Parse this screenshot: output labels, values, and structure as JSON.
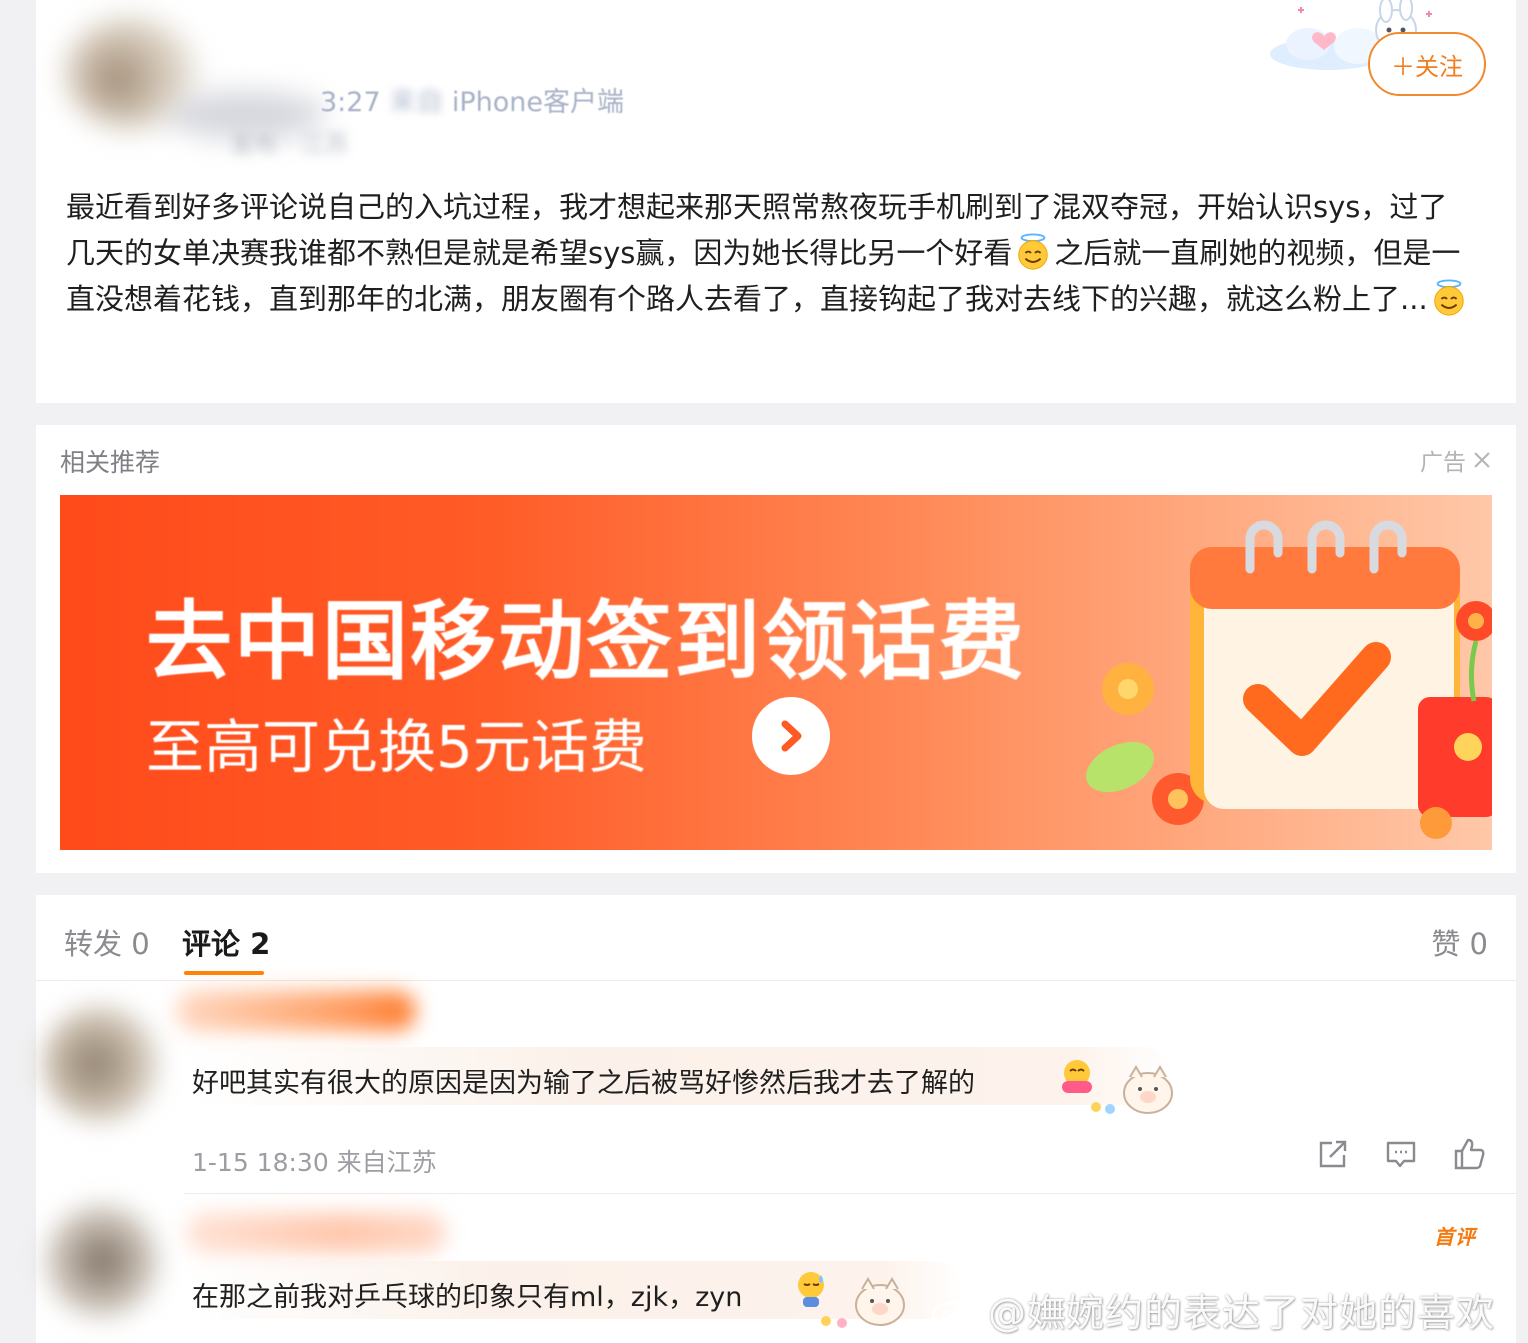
{
  "post": {
    "meta_time": "3:27",
    "meta_source": "iPhone客户端",
    "follow_label": "＋关注",
    "text_part1": "最近看到好多评论说自己的入坑过程，我才想起来那天照常熬夜玩手机刷到了混双夺冠，开始认识sys，过了几天的女单决赛我谁都不熟但是就是希望sys赢，因为她长得比另一个好看",
    "text_part2": "之后就一直刷她的视频，但是一直没想着花钱，直到那年的北满，朋友圈有个路人去看了，直接钩起了我对去线下的兴趣，就这么粉上了...",
    "emoji": "smiling-face-with-halo"
  },
  "related": {
    "title": "相关推荐",
    "ad_label": "广告",
    "ad": {
      "title": "去中国移动签到领话费",
      "subtitle": "至高可兑换5元话费",
      "brand_color": "#ff4a1a"
    }
  },
  "tabs": {
    "repost": "转发 0",
    "comment": "评论 2",
    "like": "赞 0"
  },
  "comments": [
    {
      "text": "好吧其实有很大的原因是因为输了之后被骂好惨然后我才去了解的",
      "meta": "1-15 18:30 来自江苏"
    },
    {
      "badge": "首评",
      "text": "在那之前我对乒乓球的印象只有ml，zjk，zyn"
    }
  ],
  "watermark": "@嫵婉约的表达了对她的喜欢",
  "colors": {
    "accent_orange": "#ff8200",
    "follow_orange": "#f07e1f"
  }
}
